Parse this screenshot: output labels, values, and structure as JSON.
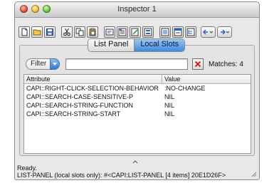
{
  "window": {
    "title": "Inspector 1"
  },
  "toolbar": {
    "buttons": [
      {
        "icon": "new-document-icon"
      },
      {
        "icon": "open-folder-icon"
      },
      {
        "icon": "save-icon"
      },
      {
        "icon": "cut-icon"
      },
      {
        "icon": "copy-icon"
      },
      {
        "icon": "paste-icon"
      },
      {
        "icon": "inspect-slot-icon"
      },
      {
        "icon": "browse-class-icon"
      },
      {
        "icon": "edit-definition-icon"
      },
      {
        "icon": "browse-generic-icon"
      },
      {
        "icon": "list-panel-icon"
      },
      {
        "icon": "interface-builder-icon"
      },
      {
        "icon": "tree-icon"
      }
    ],
    "nav": {
      "back_icon": "back-arrow-icon",
      "forward_icon": "forward-arrow-icon"
    }
  },
  "tabs": [
    {
      "label": "List Panel",
      "active": false
    },
    {
      "label": "Local Slots",
      "active": true
    }
  ],
  "filter": {
    "select_value": "Filter",
    "input_value": "",
    "matches_label": "Matches: 4"
  },
  "table": {
    "columns": [
      "Attribute",
      "Value"
    ],
    "rows": [
      {
        "attribute": "CAPI::RIGHT-CLICK-SELECTION-BEHAVIOR",
        "value": ":NO-CHANGE"
      },
      {
        "attribute": "CAPI::SEARCH-CASE-SENSITIVE-P",
        "value": "NIL"
      },
      {
        "attribute": "CAPI::SEARCH-STRING-FUNCTION",
        "value": "NIL"
      },
      {
        "attribute": "CAPI::SEARCH-STRING-START",
        "value": "NIL"
      }
    ]
  },
  "status": {
    "line1": "Ready.",
    "line2": "LIST-PANEL (local slots only): #<CAPI:LIST-PANEL [4 items] 20E1D26F>"
  },
  "colors": {
    "accent": "#3f8ae0",
    "clear_x": "#d61f1f"
  }
}
